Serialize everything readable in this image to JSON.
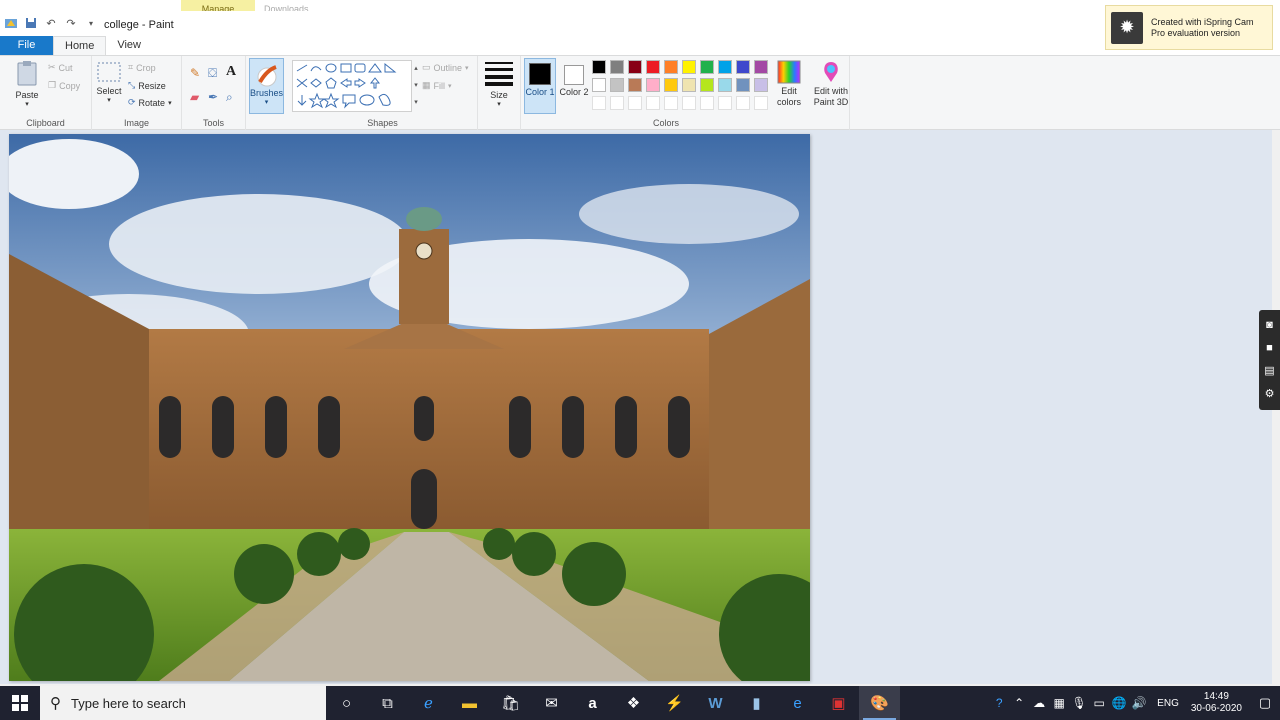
{
  "window": {
    "title": "college - Paint",
    "context_tab_manage": "Manage",
    "context_tab_downloads": "Downloads"
  },
  "tabs": {
    "file": "File",
    "home": "Home",
    "view": "View"
  },
  "clipboard": {
    "paste": "Paste",
    "cut": "Cut",
    "copy": "Copy",
    "group": "Clipboard"
  },
  "image": {
    "select": "Select",
    "crop": "Crop",
    "resize": "Resize",
    "rotate": "Rotate",
    "group": "Image"
  },
  "tools": {
    "group": "Tools",
    "brushes": "Brushes"
  },
  "shapes": {
    "outline": "Outline",
    "fill": "Fill",
    "group": "Shapes"
  },
  "size": {
    "label": "Size"
  },
  "colors": {
    "color1": "Color 1",
    "color2": "Color 2",
    "edit_colors": "Edit colors",
    "edit_paint3d": "Edit with Paint 3D",
    "group": "Colors",
    "color1_value": "#000000",
    "color2_value": "#ffffff",
    "palette_row1": [
      "#000000",
      "#7f7f7f",
      "#880015",
      "#ed1c24",
      "#ff7f27",
      "#fff200",
      "#22b14c",
      "#00a2e8",
      "#3f48cc",
      "#a349a4"
    ],
    "palette_row2": [
      "#ffffff",
      "#c3c3c3",
      "#b97a57",
      "#ffaec9",
      "#ffc90e",
      "#efe4b0",
      "#b5e61d",
      "#99d9ea",
      "#7092be",
      "#c8bfe7"
    ]
  },
  "ispring": {
    "text": "Created with iSpring Cam Pro evaluation version"
  },
  "taskbar": {
    "search_placeholder": "Type here to search",
    "lang": "ENG",
    "time": "14:49",
    "date": "30-06-2020"
  }
}
